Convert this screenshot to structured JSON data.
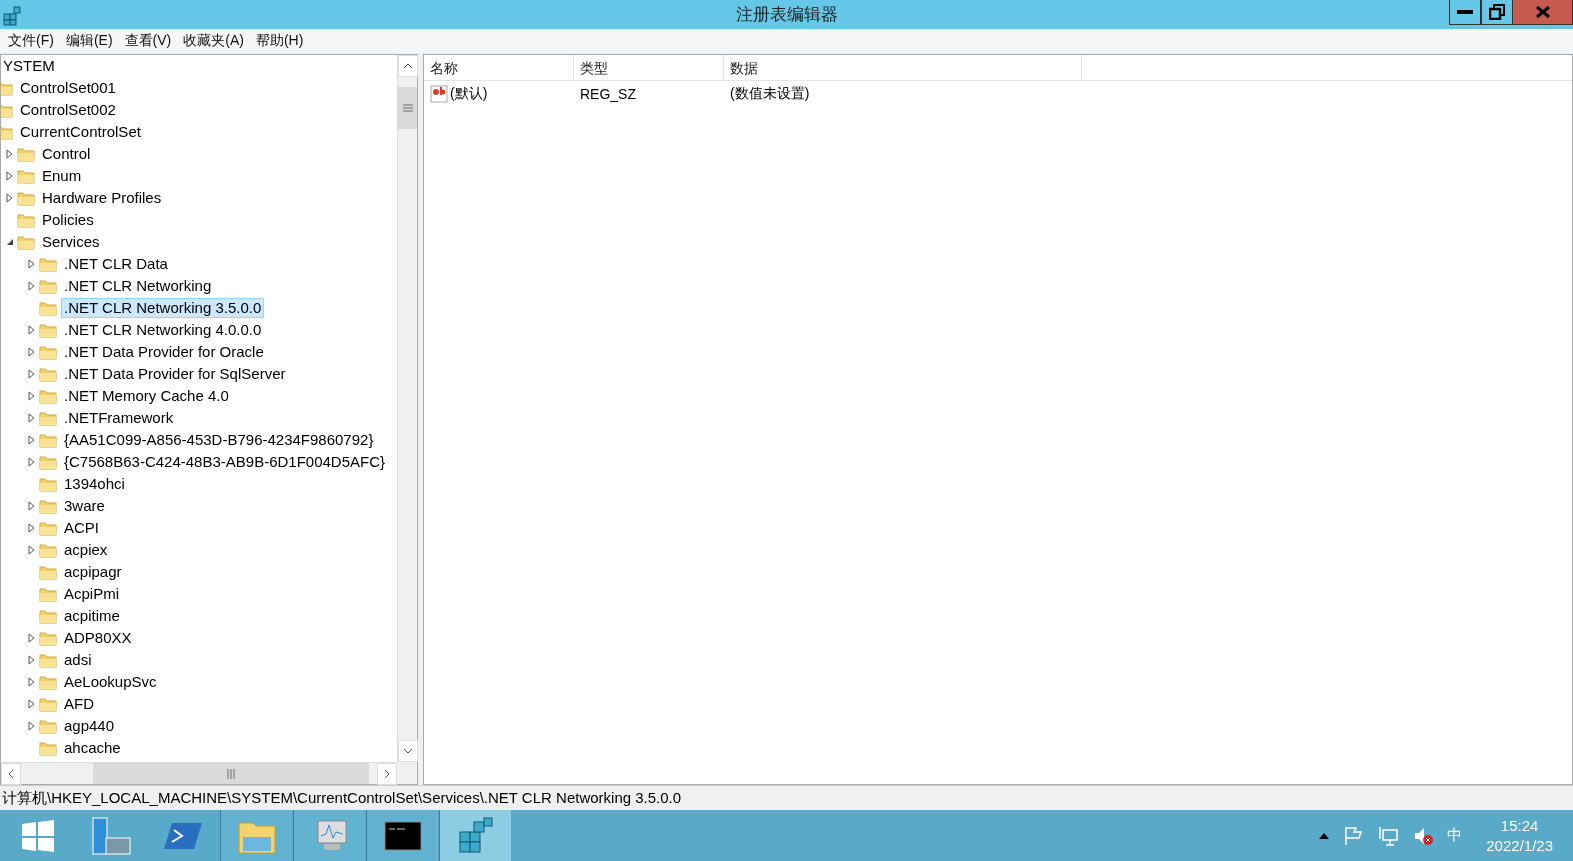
{
  "window": {
    "title": "注册表编辑器"
  },
  "menu": [
    "文件(F)",
    "编辑(E)",
    "查看(V)",
    "收藏夹(A)",
    "帮助(H)"
  ],
  "tree": [
    {
      "label": "YSTEM",
      "selected": false,
      "children": [
        {
          "label": "ControlSet001",
          "selected": false
        },
        {
          "label": "ControlSet002",
          "selected": false
        },
        {
          "label": "CurrentControlSet",
          "selected": false,
          "children": [
            {
              "label": "Control",
              "selected": false,
              "expandable": true,
              "expanded": false
            },
            {
              "label": "Enum",
              "selected": false,
              "expandable": true,
              "expanded": false
            },
            {
              "label": "Hardware Profiles",
              "selected": false,
              "expandable": true,
              "expanded": false
            },
            {
              "label": "Policies",
              "selected": false,
              "expandable": false,
              "expanded": false
            },
            {
              "label": "Services",
              "selected": false,
              "expandable": true,
              "expanded": true,
              "children": [
                {
                  "label": ".NET CLR Data",
                  "selected": false,
                  "expandable": true,
                  "expanded": false
                },
                {
                  "label": ".NET CLR Networking",
                  "selected": false,
                  "expandable": true,
                  "expanded": false
                },
                {
                  "label": ".NET CLR Networking 3.5.0.0",
                  "selected": true,
                  "expandable": false,
                  "expanded": false
                },
                {
                  "label": ".NET CLR Networking 4.0.0.0",
                  "selected": false,
                  "expandable": true,
                  "expanded": false
                },
                {
                  "label": ".NET Data Provider for Oracle",
                  "selected": false,
                  "expandable": true,
                  "expanded": false
                },
                {
                  "label": ".NET Data Provider for SqlServer",
                  "selected": false,
                  "expandable": true,
                  "expanded": false
                },
                {
                  "label": ".NET Memory Cache 4.0",
                  "selected": false,
                  "expandable": true,
                  "expanded": false
                },
                {
                  "label": ".NETFramework",
                  "selected": false,
                  "expandable": true,
                  "expanded": false
                },
                {
                  "label": "{AA51C099-A856-453D-B796-4234F9860792}",
                  "selected": false,
                  "expandable": true,
                  "expanded": false
                },
                {
                  "label": "{C7568B63-C424-48B3-AB9B-6D1F004D5AFC}",
                  "selected": false,
                  "expandable": true,
                  "expanded": false
                },
                {
                  "label": "1394ohci",
                  "selected": false,
                  "expandable": false,
                  "expanded": false
                },
                {
                  "label": "3ware",
                  "selected": false,
                  "expandable": true,
                  "expanded": false
                },
                {
                  "label": "ACPI",
                  "selected": false,
                  "expandable": true,
                  "expanded": false
                },
                {
                  "label": "acpiex",
                  "selected": false,
                  "expandable": true,
                  "expanded": false
                },
                {
                  "label": "acpipagr",
                  "selected": false,
                  "expandable": false,
                  "expanded": false
                },
                {
                  "label": "AcpiPmi",
                  "selected": false,
                  "expandable": false,
                  "expanded": false
                },
                {
                  "label": "acpitime",
                  "selected": false,
                  "expandable": false,
                  "expanded": false
                },
                {
                  "label": "ADP80XX",
                  "selected": false,
                  "expandable": true,
                  "expanded": false
                },
                {
                  "label": "adsi",
                  "selected": false,
                  "expandable": true,
                  "expanded": false
                },
                {
                  "label": "AeLookupSvc",
                  "selected": false,
                  "expandable": true,
                  "expanded": false
                },
                {
                  "label": "AFD",
                  "selected": false,
                  "expandable": true,
                  "expanded": false
                },
                {
                  "label": "agp440",
                  "selected": false,
                  "expandable": true,
                  "expanded": false
                },
                {
                  "label": "ahcache",
                  "selected": false,
                  "expandable": false,
                  "expanded": false
                }
              ]
            }
          ]
        }
      ]
    }
  ],
  "values": {
    "columns": [
      "名称",
      "类型",
      "数据"
    ],
    "rows": [
      {
        "name": "(默认)",
        "type": "REG_SZ",
        "data": "(数值未设置)"
      }
    ]
  },
  "status_bar": "计算机\\HKEY_LOCAL_MACHINE\\SYSTEM\\CurrentControlSet\\Services\\.NET CLR Networking 3.5.0.0",
  "taskbar": {
    "apps": [
      {
        "kind": "server",
        "selected": false
      },
      {
        "kind": "powershell",
        "selected": false
      },
      {
        "kind": "explorer",
        "selected": false
      },
      {
        "kind": "monitor",
        "selected": false
      },
      {
        "kind": "cmd",
        "selected": false
      },
      {
        "kind": "regedit",
        "selected": true
      }
    ],
    "ime": "中",
    "time": "15:24",
    "date": "2022/1/23"
  }
}
